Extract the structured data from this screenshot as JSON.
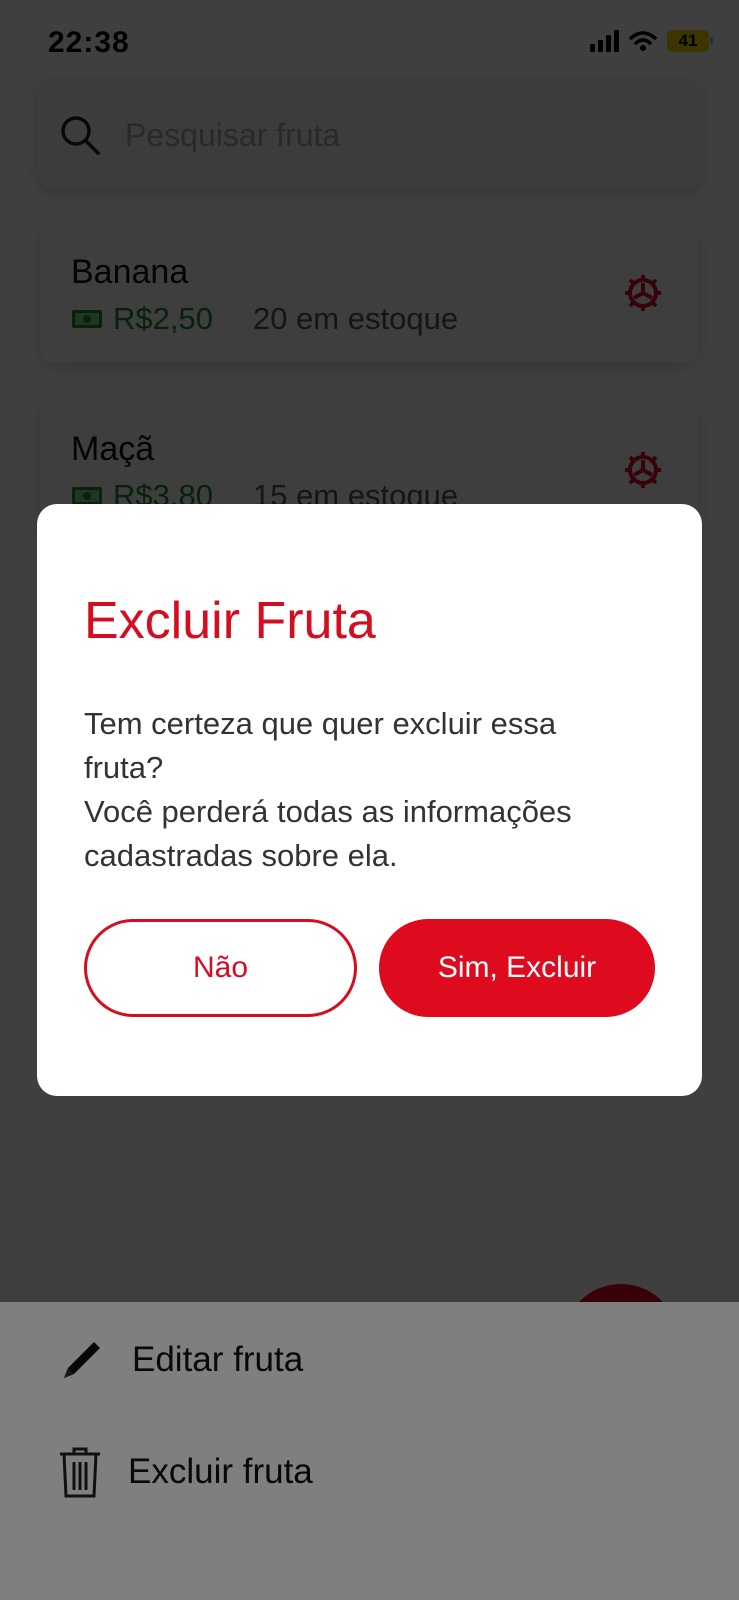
{
  "status_bar": {
    "time": "22:38",
    "battery": "41"
  },
  "search": {
    "placeholder": "Pesquisar fruta"
  },
  "fruits": [
    {
      "name": "Banana",
      "price": "R$2,50",
      "stock": "20 em estoque"
    },
    {
      "name": "Maçã",
      "price": "R$3,80",
      "stock": "15 em estoque"
    }
  ],
  "action_sheet": {
    "edit_label": "Editar fruta",
    "delete_label": "Excluir fruta"
  },
  "dialog": {
    "title": "Excluir Fruta",
    "message_lines": [
      "Tem certeza que quer excluir essa",
      "fruta?",
      "Você perderá todas as informações",
      "cadastradas sobre ela."
    ],
    "no_label": "Não",
    "yes_label": "Sim, Excluir"
  },
  "colors": {
    "accent": "#d50d20",
    "price": "#1f8a2e"
  },
  "icons": [
    "search-icon",
    "money-icon",
    "gear-icon",
    "pencil-icon",
    "trash-icon",
    "signal-icon",
    "wifi-icon",
    "battery-icon"
  ]
}
